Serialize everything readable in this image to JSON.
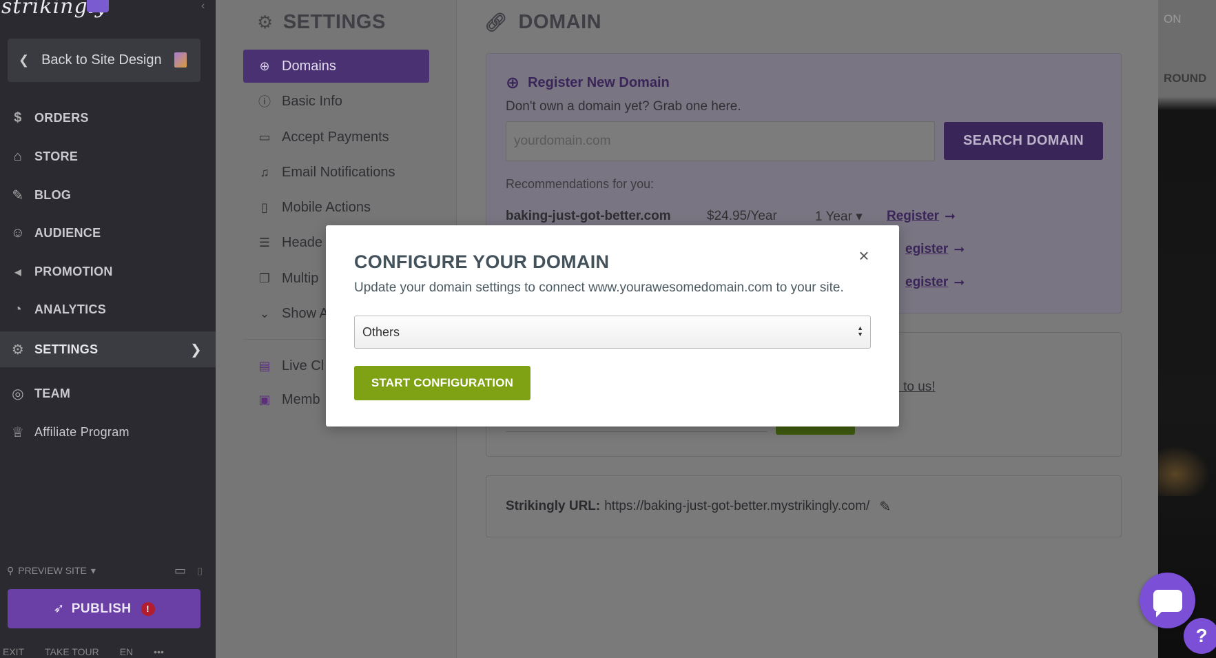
{
  "sidebar": {
    "logo": "strikingly",
    "back_label": "Back to Site Design",
    "items": [
      {
        "label": "ORDERS",
        "icon": "dollar-circle-icon"
      },
      {
        "label": "STORE",
        "icon": "store-icon"
      },
      {
        "label": "BLOG",
        "icon": "pen-icon"
      },
      {
        "label": "AUDIENCE",
        "icon": "people-icon"
      },
      {
        "label": "PROMOTION",
        "icon": "megaphone-icon"
      },
      {
        "label": "ANALYTICS",
        "icon": "pie-icon"
      },
      {
        "label": "SETTINGS",
        "icon": "gear-icon"
      },
      {
        "label": "TEAM",
        "icon": "team-icon"
      },
      {
        "label": "Affiliate Program",
        "icon": "trophy-icon"
      }
    ],
    "preview_label": "PREVIEW SITE",
    "publish_label": "PUBLISH",
    "publish_alert": "!",
    "bottom": {
      "exit": "EXIT",
      "tour": "TAKE TOUR",
      "lang": "EN",
      "more": "•••"
    }
  },
  "settings": {
    "title": "SETTINGS",
    "items": [
      {
        "label": "Domains",
        "icon": "globe-icon"
      },
      {
        "label": "Basic Info",
        "icon": "info-icon"
      },
      {
        "label": "Accept Payments",
        "icon": "card-icon"
      },
      {
        "label": "Email Notifications",
        "icon": "bell-icon"
      },
      {
        "label": "Mobile Actions",
        "icon": "phone-icon"
      },
      {
        "label": "Heade",
        "icon": "header-icon"
      },
      {
        "label": "Multip",
        "icon": "pages-icon"
      },
      {
        "label": "Show A",
        "icon": "chevron-down-icon"
      },
      {
        "label": "Live Cl",
        "icon": "chat-icon"
      },
      {
        "label": "Memb",
        "icon": "member-icon"
      }
    ]
  },
  "domain": {
    "title": "DOMAIN",
    "register_title": "Register New Domain",
    "register_sub": "Don't own a domain yet? Grab one here.",
    "input_placeholder": "yourdomain.com",
    "search_button": "SEARCH DOMAIN",
    "rec_label": "Recommendations for you:",
    "recommendations": [
      {
        "name": "baking-just-got-better.com",
        "price": "$24.95/Year",
        "period": "1 Year",
        "action": "Register"
      },
      {
        "name": "",
        "price": "",
        "period": "",
        "action": "egister"
      },
      {
        "name": "",
        "price": "",
        "period": "",
        "action": "egister"
      }
    ],
    "own_link": "in to us!",
    "url_label": "Strikingly URL:",
    "url_value": "https://baking-just-got-better.mystrikingly.com/"
  },
  "strip": {
    "txt1": "ON",
    "txt2": "ROUND"
  },
  "modal": {
    "title": "CONFIGURE YOUR DOMAIN",
    "close": "×",
    "description": "Update your domain settings to connect www.yourawesomedomain.com to your site.",
    "select_value": "Others",
    "button_label": "START CONFIGURATION"
  },
  "colors": {
    "accent": "#7b4fd6",
    "configure_green": "#7fa214",
    "sidebar_bg": "#2a2a30"
  }
}
